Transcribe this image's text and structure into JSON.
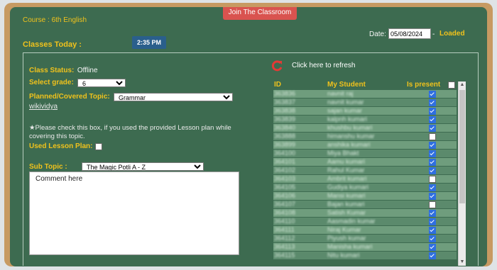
{
  "header": {
    "join_button": "Join The Classroom",
    "course_label": "Course : 6th English",
    "classes_today_label": "Classes Today :",
    "time_badge": "2:35 PM",
    "date_label": "Date:",
    "date_value": "05/08/2024",
    "date_sep": "-",
    "loaded_text": "Loaded"
  },
  "left": {
    "class_status_label": "Class Status:",
    "class_status_value": "Offline",
    "grade_label": "Select grade:",
    "grade_value": "6",
    "topic_label": "Planned/Covered Topic:",
    "topic_value": "Grammar",
    "wiki_link": "wikividya",
    "note": "★Please check this box, if you used the provided Lesson plan while covering this topic.",
    "lesson_plan_label": "Used Lesson Plan:",
    "subtopic_label": "Sub Topic :",
    "subtopic_value": "The Magic Potli A - Z",
    "comment_text": "Comment here"
  },
  "right": {
    "refresh_text": "Click here to refresh",
    "col_id": "ID",
    "col_name": "My Student",
    "col_present": "Is present"
  },
  "students": [
    {
      "id": "363836",
      "name": "navnit raj",
      "present": true
    },
    {
      "id": "363837",
      "name": "navnit kumar",
      "present": true
    },
    {
      "id": "363838",
      "name": "sajan kumar",
      "present": true
    },
    {
      "id": "363839",
      "name": "kalpnh kumari",
      "present": true
    },
    {
      "id": "363840",
      "name": "khushbu kumari",
      "present": true
    },
    {
      "id": "363888",
      "name": "himanshu kumar",
      "present": false
    },
    {
      "id": "363899",
      "name": "anshika kumari",
      "present": true
    },
    {
      "id": "364100",
      "name": "Miya Bhakt",
      "present": true
    },
    {
      "id": "364101",
      "name": "Aamu kumari",
      "present": true
    },
    {
      "id": "364102",
      "name": "Rahul Kumar",
      "present": true
    },
    {
      "id": "364103",
      "name": "Ambrit kumari",
      "present": false
    },
    {
      "id": "364105",
      "name": "Gudiya kumari",
      "present": true
    },
    {
      "id": "364106",
      "name": "Mansi kumari",
      "present": true
    },
    {
      "id": "364107",
      "name": "Bajan kumari",
      "present": false
    },
    {
      "id": "364108",
      "name": "Satish Kumar",
      "present": true
    },
    {
      "id": "364110",
      "name": "Aasmadin kumar",
      "present": true
    },
    {
      "id": "364111",
      "name": "Niraj Kumar",
      "present": true
    },
    {
      "id": "364112",
      "name": "Piyush kumar",
      "present": true
    },
    {
      "id": "364113",
      "name": "Manisha kumari",
      "present": true
    },
    {
      "id": "364115",
      "name": "Nitu kumari",
      "present": true
    }
  ],
  "colors": {
    "board": "#3d6b50",
    "frame": "#c79a62",
    "label_yellow": "#f0c21c",
    "join_red": "#d9534f",
    "badge_blue": "#2a5f8c",
    "check_blue": "#2f6fe0"
  }
}
